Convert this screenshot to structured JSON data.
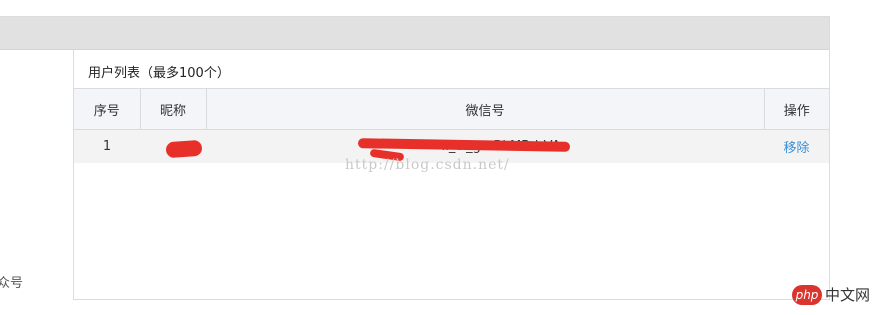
{
  "left_panel": {
    "partial_label": "众号"
  },
  "panel": {
    "title": "用户列表（最多100个）"
  },
  "table": {
    "headers": [
      "序号",
      "昵称",
      "微信号",
      "操作"
    ],
    "rows": [
      {
        "index": "1",
        "nickname": "",
        "wechat_id": "ll_ci_gmBkMBdrVAo",
        "action": "移除"
      }
    ]
  },
  "watermark": "http://blog.csdn.net/",
  "site_logo": {
    "badge": "php",
    "text": "中文网"
  },
  "colors": {
    "link": "#3b8fd6",
    "redaction": "#e8302b",
    "header_bg": "#f4f5f9",
    "row_bg": "#f3f3f3"
  }
}
